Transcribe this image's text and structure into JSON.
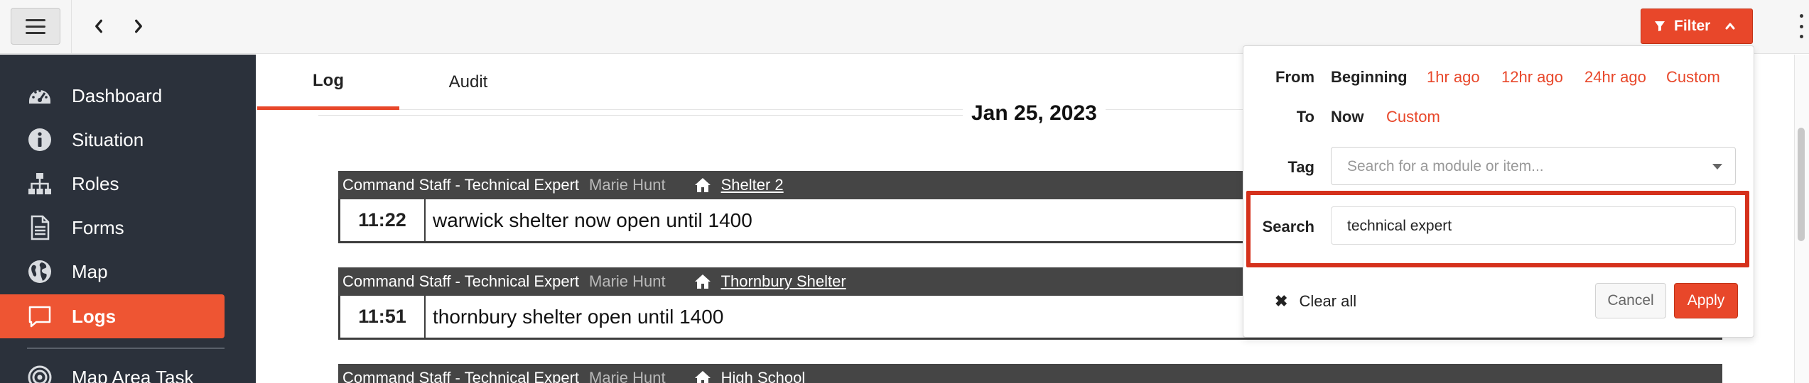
{
  "topbar": {
    "filter_label": "Filter"
  },
  "sidebar": {
    "items": [
      {
        "label": "Dashboard",
        "icon": "dashboard-icon"
      },
      {
        "label": "Situation",
        "icon": "info-icon"
      },
      {
        "label": "Roles",
        "icon": "org-chart-icon"
      },
      {
        "label": "Forms",
        "icon": "document-icon"
      },
      {
        "label": "Map",
        "icon": "globe-icon"
      },
      {
        "label": "Logs",
        "icon": "chat-icon",
        "active": true
      },
      {
        "label": "Map Area Task",
        "icon": "target-icon"
      }
    ]
  },
  "tabs": [
    {
      "label": "Log",
      "active": true
    },
    {
      "label": "Audit",
      "active": false
    }
  ],
  "log": {
    "date": "Jan 25, 2023",
    "entries": [
      {
        "role": "Command Staff - Technical Expert",
        "person": "Marie Hunt",
        "place": "Shelter 2",
        "time": "11:22",
        "text": "warwick shelter now open until 1400"
      },
      {
        "role": "Command Staff - Technical Expert",
        "person": "Marie Hunt",
        "place": "Thornbury Shelter",
        "time": "11:51",
        "text": "thornbury shelter open until 1400"
      },
      {
        "role": "Command Staff - Technical Expert",
        "person": "Marie Hunt",
        "place": "High School",
        "time": "",
        "text": ""
      }
    ]
  },
  "filter_panel": {
    "from_label": "From",
    "from_options": [
      {
        "label": "Beginning",
        "selected": true
      },
      {
        "label": "1hr ago",
        "selected": false
      },
      {
        "label": "12hr ago",
        "selected": false
      },
      {
        "label": "24hr ago",
        "selected": false
      },
      {
        "label": "Custom",
        "selected": false
      }
    ],
    "to_label": "To",
    "to_options": [
      {
        "label": "Now",
        "selected": true
      },
      {
        "label": "Custom",
        "selected": false
      }
    ],
    "tag_label": "Tag",
    "tag_placeholder": "Search for a module or item...",
    "search_label": "Search",
    "search_value": "technical expert",
    "clear_all_label": "Clear all",
    "cancel_label": "Cancel",
    "apply_label": "Apply"
  },
  "colors": {
    "accent": "#e8472a",
    "sidebar_bg": "#2b313b",
    "entry_header_bg": "#454545",
    "highlight_box": "#d5311c"
  }
}
